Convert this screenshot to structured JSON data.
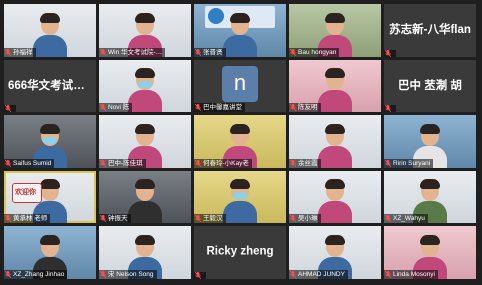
{
  "colors": {
    "background": "#1f1f1f",
    "tile_dark": "#3a3a3a",
    "active_speaker": "#d9c84a"
  },
  "tiles": [
    {
      "name": "孙福祥",
      "style": "video",
      "tone": "w",
      "person": "m"
    },
    {
      "name": "Win 华文考试院-…",
      "style": "video",
      "tone": "w",
      "person": "f"
    },
    {
      "name": "张晋贤",
      "style": "video",
      "tone": "b",
      "person": "m",
      "logo": true
    },
    {
      "name": "Bau hongyan",
      "style": "video",
      "tone": "g",
      "person": "f"
    },
    {
      "name": "苏志新-八华flan",
      "style": "name"
    },
    {
      "name": "666华文考试院-…",
      "style": "name"
    },
    {
      "name": "Novi 陈",
      "style": "video",
      "tone": "w",
      "person": "f",
      "mask": true
    },
    {
      "name": "巴中馨嘉讲堂",
      "style": "letter",
      "letter": "n"
    },
    {
      "name": "陈友明",
      "style": "video",
      "tone": "p",
      "person": "f"
    },
    {
      "name": "巴中 苤淛 胡",
      "style": "name"
    },
    {
      "name": "Saifus Sumid",
      "style": "video",
      "tone": "d",
      "person": "m",
      "mask": true
    },
    {
      "name": "巴中-陈佳琪",
      "style": "video",
      "tone": "w",
      "person": "f"
    },
    {
      "name": "何春玲-小Kay老",
      "style": "video",
      "tone": "y",
      "person": "f"
    },
    {
      "name": "余丝霞",
      "style": "video",
      "tone": "w",
      "person": "f"
    },
    {
      "name": "Ririn Suryani",
      "style": "video",
      "tone": "b",
      "person": "t"
    },
    {
      "name": "黄承林 老师",
      "style": "video",
      "tone": "w",
      "person": "m",
      "hand": "欢迎你",
      "speaking": true
    },
    {
      "name": "钟振天",
      "style": "video",
      "tone": "d",
      "person": "k"
    },
    {
      "name": "王毅汉",
      "style": "video",
      "tone": "y",
      "person": "m",
      "mask": true
    },
    {
      "name": "吴小琳",
      "style": "video",
      "tone": "w",
      "person": "f"
    },
    {
      "name": "XZ_Wahyu",
      "style": "video",
      "tone": "w",
      "person": "o"
    },
    {
      "name": "XZ_Zhang Jinhao",
      "style": "video",
      "tone": "b",
      "person": "k"
    },
    {
      "name": "宋 Nelson Song",
      "style": "video",
      "tone": "w",
      "person": "m"
    },
    {
      "name": "Ricky zheng",
      "style": "name"
    },
    {
      "name": "AHMAD JUNDY",
      "style": "video",
      "tone": "w",
      "person": "m"
    },
    {
      "name": "Linda Mosonyi",
      "style": "video",
      "tone": "p",
      "person": "f"
    }
  ]
}
